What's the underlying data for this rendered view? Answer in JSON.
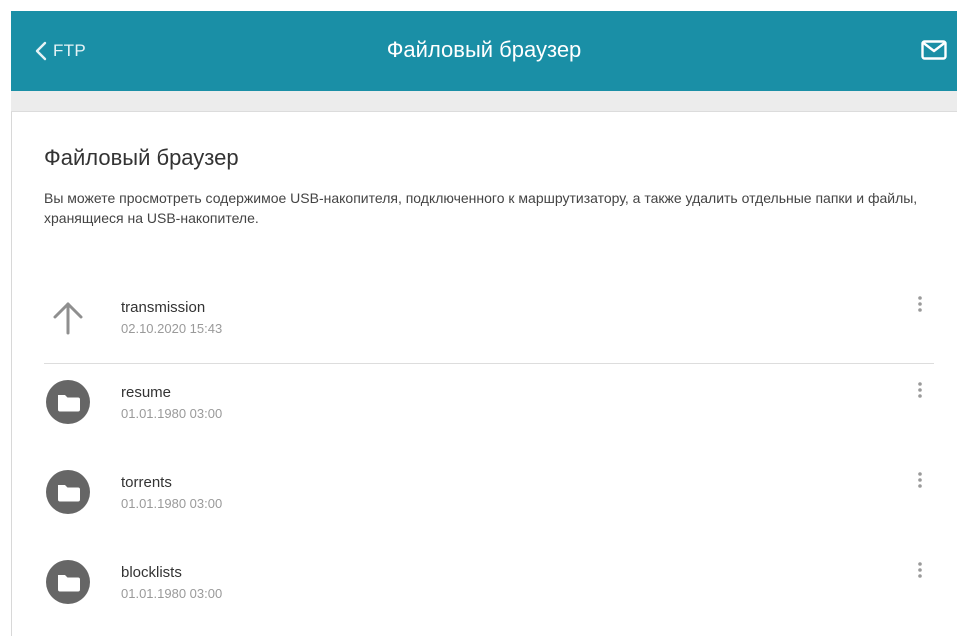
{
  "header": {
    "back_label": "FTP",
    "title": "Файловый браузер",
    "mail_icon": "mail-icon",
    "color": "#1a8fa6"
  },
  "section": {
    "title": "Файловый браузер",
    "description": "Вы можете просмотреть содержимое USB-накопителя, подключенного к маршрутизатору, а также удалить отдельные папки и файлы, хранящиеся на USB-накопителе."
  },
  "files": [
    {
      "icon": "arrow-up-icon",
      "name": "transmission",
      "date": "02.10.2020 15:43"
    },
    {
      "icon": "folder-icon",
      "name": "resume",
      "date": "01.01.1980 03:00"
    },
    {
      "icon": "folder-icon",
      "name": "torrents",
      "date": "01.01.1980 03:00"
    },
    {
      "icon": "folder-icon",
      "name": "blocklists",
      "date": "01.01.1980 03:00"
    }
  ]
}
